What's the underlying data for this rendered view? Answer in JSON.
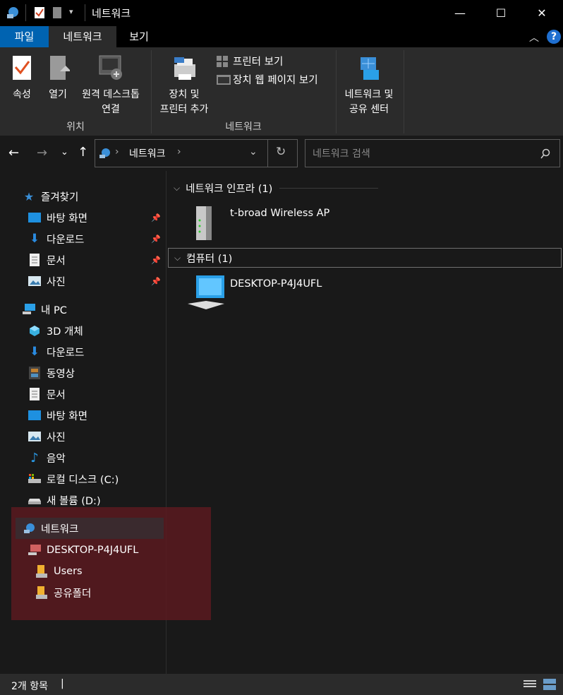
{
  "window": {
    "title": "네트워크",
    "minimize": "—",
    "maximize": "☐",
    "close": "✕"
  },
  "tabs": {
    "file": "파일",
    "network": "네트워크",
    "view": "보기"
  },
  "ribbon": {
    "properties": "속성",
    "open": "열기",
    "remote_desktop_1": "원격 데스크톱",
    "remote_desktop_2": "연결",
    "add_device_1": "장치 및",
    "add_device_2": "프린터 추가",
    "view_printers": "프린터 보기",
    "view_device_webpage": "장치 웹 페이지 보기",
    "network_center_1": "네트워크 및",
    "network_center_2": "공유 센터",
    "group_location": "위치",
    "group_network": "네트워크"
  },
  "address": {
    "root": "네트워크",
    "sep": "›"
  },
  "search": {
    "placeholder": "네트워크 검색"
  },
  "nav": {
    "favorites": "즐겨찾기",
    "fav_items": [
      "바탕 화면",
      "다운로드",
      "문서",
      "사진"
    ],
    "this_pc": "내 PC",
    "pc_items": [
      "3D 개체",
      "다운로드",
      "동영상",
      "문서",
      "바탕 화면",
      "사진",
      "음악",
      "로컬 디스크 (C:)",
      "새 볼륨 (D:)"
    ],
    "network": "네트워크",
    "computer": "DESKTOP-P4J4UFL",
    "shares": [
      "Users",
      "공유폴더"
    ]
  },
  "content": {
    "group1": "네트워크 인프라 (1)",
    "item1": "t-broad Wireless AP",
    "group2": "컴퓨터 (1)",
    "item2": "DESKTOP-P4J4UFL"
  },
  "status": {
    "count": "2개 항목",
    "sep": "|"
  },
  "colors": {
    "accent": "#0063b1",
    "highlight": "#5a1a20",
    "help": "#1f6fd0"
  }
}
